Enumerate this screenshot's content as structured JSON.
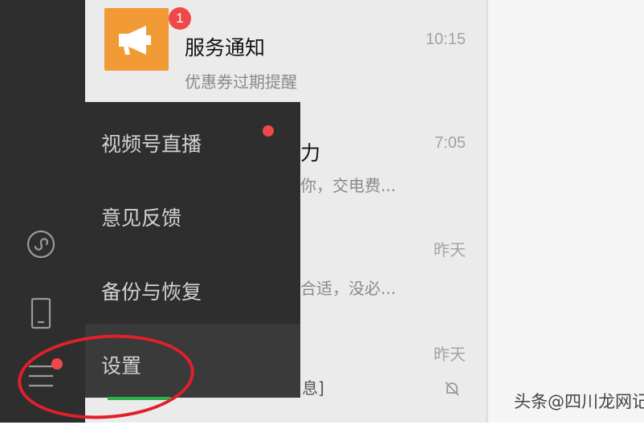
{
  "sidebar": {
    "icons": [
      "mini-program-icon",
      "phone-icon",
      "menu-icon"
    ],
    "menu_has_dot": true
  },
  "chats": [
    {
      "title": "服务通知",
      "preview": "优惠券过期提醒",
      "time": "10:15",
      "badge": "1"
    },
    {
      "title_fragment": "力",
      "preview_fragment": "你，交电费...",
      "time": "7:05"
    },
    {
      "preview_fragment": "合适，没必...",
      "time": "昨天"
    },
    {
      "preview_fragment": "息]",
      "time": "昨天",
      "muted": true
    }
  ],
  "menu": {
    "items": [
      {
        "label": "视频号直播",
        "dot": true
      },
      {
        "label": "意见反馈"
      },
      {
        "label": "备份与恢复"
      },
      {
        "label": "设置",
        "active": true
      }
    ]
  },
  "colors": {
    "sidebar": "#2e2e2e",
    "badge": "#f04848",
    "avatar": "#f29a36",
    "annotation": "#e0202a"
  },
  "watermark": {
    "prefix": "头条",
    "text": "@四川龙网记"
  }
}
